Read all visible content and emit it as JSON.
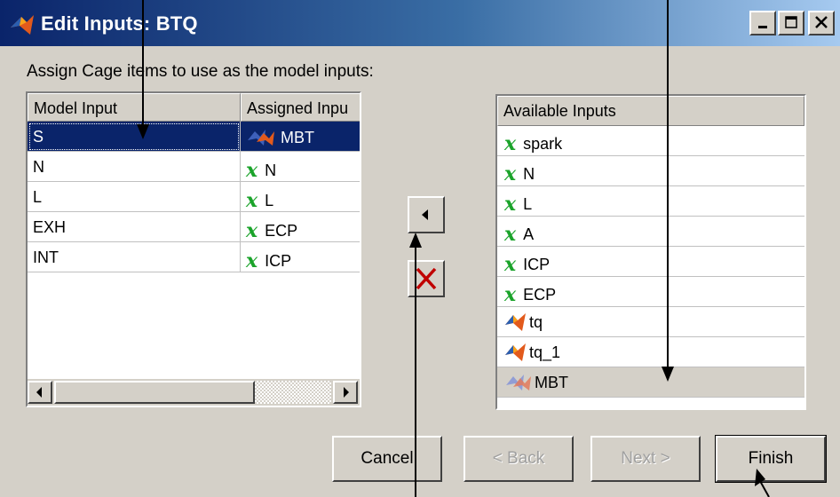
{
  "window": {
    "title": "Edit Inputs: BTQ",
    "instruction": "Assign Cage items to use as the model inputs:"
  },
  "model_table": {
    "columns": [
      "Model Input",
      "Assigned Inpu"
    ],
    "rows": [
      {
        "model_input": "S",
        "assigned": "MBT",
        "assigned_icon": "model-icon",
        "selected": true
      },
      {
        "model_input": "N",
        "assigned": "N",
        "assigned_icon": "variable-x-icon",
        "selected": false
      },
      {
        "model_input": "L",
        "assigned": "L",
        "assigned_icon": "variable-x-icon",
        "selected": false
      },
      {
        "model_input": "EXH",
        "assigned": "ECP",
        "assigned_icon": "variable-x-icon",
        "selected": false
      },
      {
        "model_input": "INT",
        "assigned": "ICP",
        "assigned_icon": "variable-x-icon",
        "selected": false
      }
    ]
  },
  "available": {
    "header": "Available Inputs",
    "items": [
      {
        "label": "spark",
        "icon": "variable-x-icon"
      },
      {
        "label": "N",
        "icon": "variable-x-icon"
      },
      {
        "label": "L",
        "icon": "variable-x-icon"
      },
      {
        "label": "A",
        "icon": "variable-x-icon"
      },
      {
        "label": "ICP",
        "icon": "variable-x-icon"
      },
      {
        "label": "ECP",
        "icon": "variable-x-icon"
      },
      {
        "label": "tq",
        "icon": "matlab-model-icon"
      },
      {
        "label": "tq_1",
        "icon": "matlab-model-icon"
      },
      {
        "label": "MBT",
        "icon": "matlab-model-faded-icon",
        "selected": true
      }
    ]
  },
  "middle_buttons": {
    "assign_icon": "arrow-left-icon",
    "remove_icon": "red-x-icon"
  },
  "buttons": {
    "cancel": "Cancel",
    "back": "< Back",
    "next": "Next >",
    "finish": "Finish"
  },
  "variable_glyph": "x",
  "colors": {
    "selection": "#0a246a",
    "variable_icon": "#1aa32a",
    "remove_icon": "#c00000",
    "dialog_bg": "#d4d0c8"
  }
}
